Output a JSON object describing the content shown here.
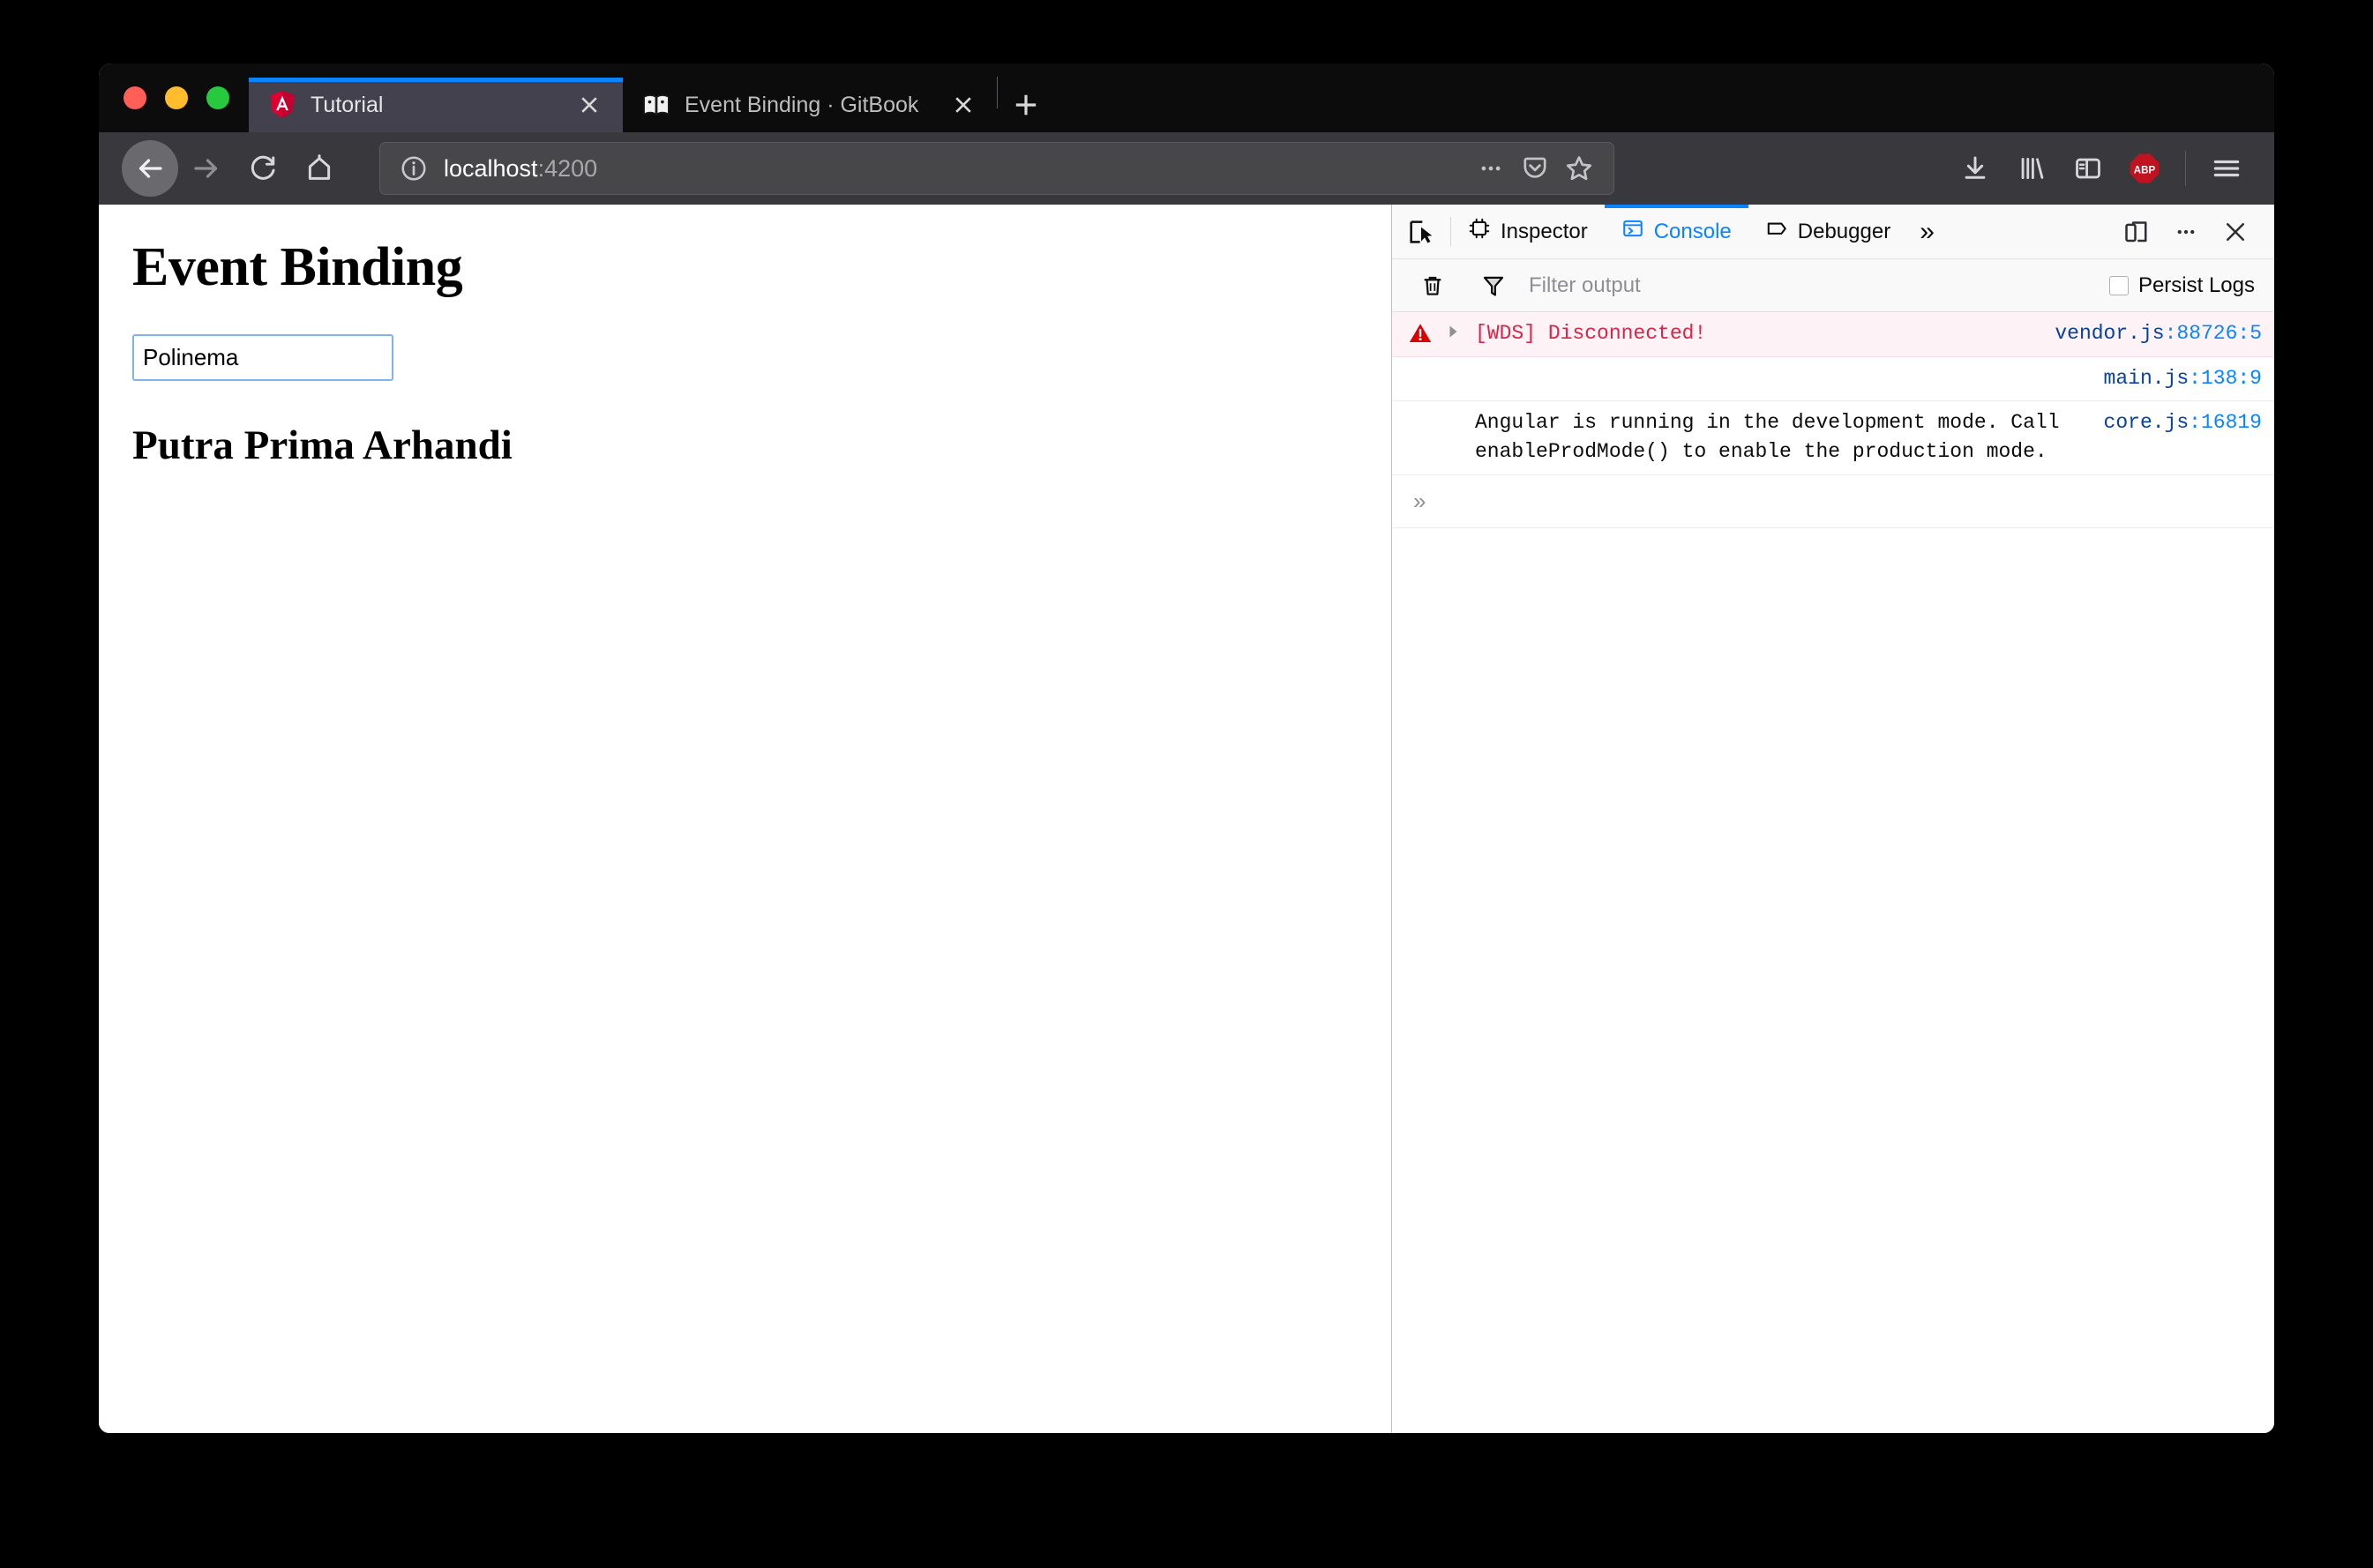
{
  "window": {
    "traffic_lights": [
      "close",
      "minimize",
      "zoom"
    ]
  },
  "tabs": [
    {
      "title": "Tutorial",
      "favicon": "angular-icon",
      "active": true,
      "close_label": "×"
    },
    {
      "title": "Event Binding · GitBook",
      "favicon": "gitbook-icon",
      "active": false,
      "close_label": "×"
    }
  ],
  "newtab_label": "+",
  "navigation": {
    "back": "back-arrow",
    "forward": "forward-arrow",
    "reload": "reload",
    "home": "home"
  },
  "urlbar": {
    "host": "localhost",
    "port": ":4200",
    "info_icon": "info-circle-icon",
    "page_actions_icon": "ellipsis-icon",
    "pocket_icon": "pocket-icon",
    "bookmark_icon": "star-icon"
  },
  "toolbar_right": {
    "downloads": "download-icon",
    "library": "library-icon",
    "sidebar": "sidebar-icon",
    "adblock": "ABP",
    "menu": "hamburger-icon"
  },
  "page": {
    "heading": "Event Binding",
    "input_value": "Polinema",
    "input_placeholder": "",
    "subheading": "Putra Prima Arhandi"
  },
  "devtools": {
    "picker_icon": "element-picker-icon",
    "tabs": [
      {
        "label": "Inspector",
        "icon": "inspector-icon",
        "active": false
      },
      {
        "label": "Console",
        "icon": "console-icon",
        "active": true
      },
      {
        "label": "Debugger",
        "icon": "debugger-icon",
        "active": false
      }
    ],
    "overflow_label": "»",
    "responsive_icon": "responsive-design-mode-icon",
    "meatball_icon": "ellipsis-icon",
    "close_icon": "close-icon",
    "filter": {
      "clear_icon": "trash-icon",
      "funnel_icon": "funnel-icon",
      "placeholder": "Filter output",
      "value": "",
      "persist_label": "Persist Logs",
      "persist_checked": false
    },
    "messages": [
      {
        "level": "error",
        "icon": "warning-triangle-icon",
        "expandable": true,
        "text": "[WDS] Disconnected!",
        "source_file": "vendor.js",
        "source_pos": ":88726:5"
      },
      {
        "level": "log",
        "icon": "",
        "expandable": false,
        "text": "",
        "source_file": "main.js",
        "source_pos": ":138:9"
      },
      {
        "level": "log",
        "icon": "",
        "expandable": false,
        "text": "Angular is running in the development mode. Call\nenableProdMode() to enable the production mode.",
        "source_file": "core.js",
        "source_pos": ":16819"
      }
    ],
    "prompt_label": "»"
  },
  "colors": {
    "accent_blue": "#0a84ff",
    "error_red": "#d8254a",
    "error_bg": "#fdf2f5",
    "tabstrip_bg": "#0c0c0d",
    "navbar_bg": "#38383d",
    "devtools_toolbar_bg": "#f9f9fa",
    "input_focus_border": "#7eb4ea"
  }
}
